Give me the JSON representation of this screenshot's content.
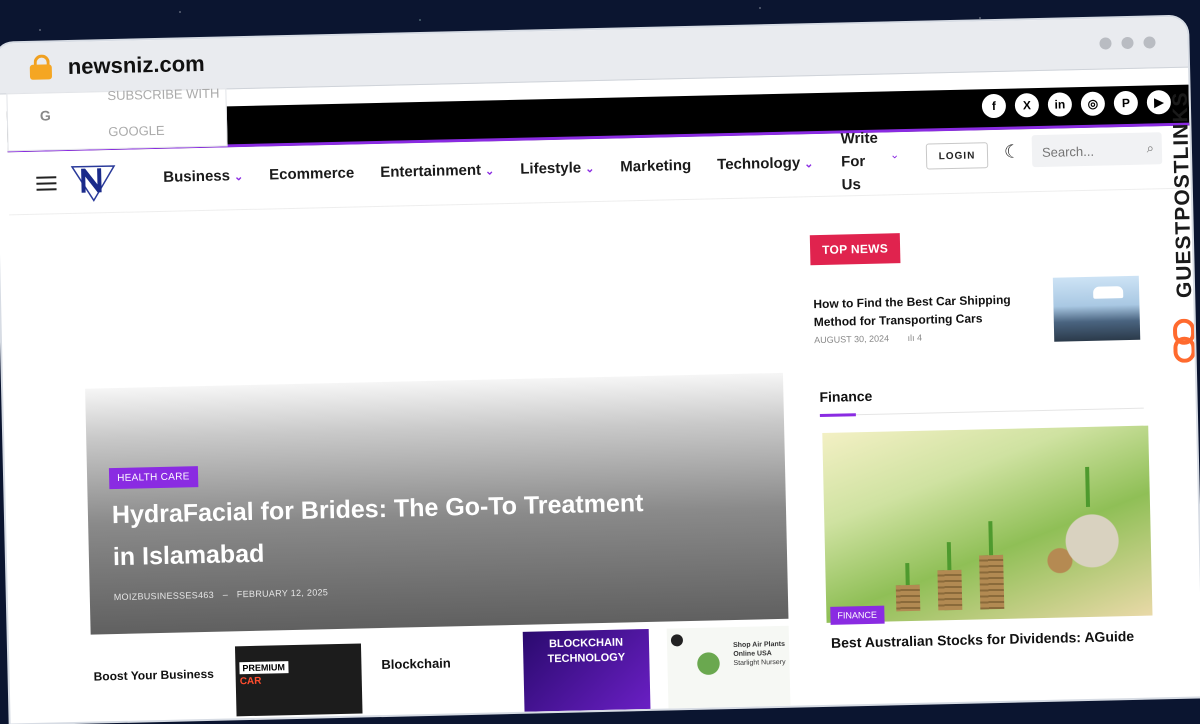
{
  "browser": {
    "url": "newsniz.com"
  },
  "google_popup": {
    "g": "G",
    "line1": "SUBSCRIBE WITH",
    "line2": "GOOGLE"
  },
  "social": {
    "items": [
      "f",
      "X",
      "in",
      "◎",
      "P",
      "▶"
    ]
  },
  "nav": {
    "items": [
      {
        "label": "Business",
        "dropdown": true
      },
      {
        "label": "Ecommerce",
        "dropdown": false
      },
      {
        "label": "Entertainment",
        "dropdown": true
      },
      {
        "label": "Lifestyle",
        "dropdown": true
      },
      {
        "label": "Marketing",
        "dropdown": false
      },
      {
        "label": "Technology",
        "dropdown": true
      }
    ],
    "write_for_us": "Write For Us",
    "login": "LOGIN",
    "search_placeholder": "Search..."
  },
  "hero": {
    "category": "HEALTH CARE",
    "title": "HydraFacial for Brides: The Go-To Treatment in Islamabad",
    "author": "MOIZBUSINESSES463",
    "separator": "–",
    "date": "FEBRUARY 12, 2025"
  },
  "cards": {
    "card1_title": "Boost Your Business",
    "card1_img_label": "PREMIUM",
    "card1_img_label2": "CAR",
    "card2_title": "Blockchain",
    "card2_img_text": "BLOCKCHAIN TECHNOLOGY",
    "card3_img_text": "Shop Air Plants Online USA",
    "card3_img_sub": "Starlight Nursery"
  },
  "sidebar": {
    "top_news_label": "TOP NEWS",
    "top_news_item": {
      "title": "How to Find the Best Car Shipping Method for Transporting Cars",
      "date": "AUGUST 30, 2024",
      "views": "4"
    },
    "finance_heading": "Finance",
    "finance_category": "FINANCE",
    "finance_title": "Best Australian Stocks for Dividends: AGuide"
  },
  "watermark": {
    "text": "GUESTPOSTLINKS"
  },
  "colors": {
    "accent": "#8a2be2",
    "top_news": "#e0234e",
    "topbar": "#000000"
  }
}
